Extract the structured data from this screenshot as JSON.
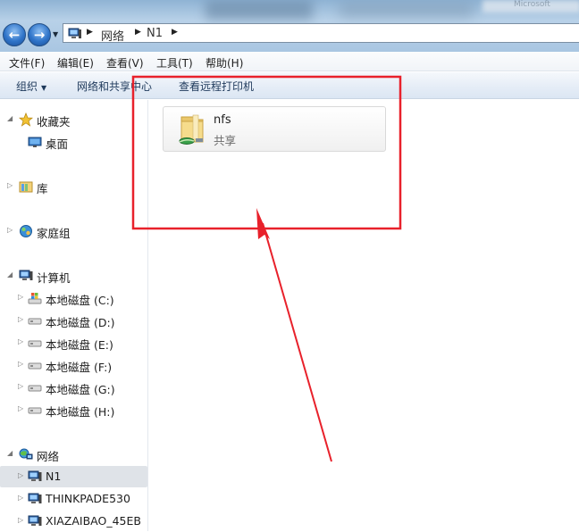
{
  "address": {
    "crumbs": [
      "网络",
      "N1"
    ]
  },
  "menu": [
    "文件(F)",
    "编辑(E)",
    "查看(V)",
    "工具(T)",
    "帮助(H)"
  ],
  "toolbar": {
    "organize": "组织",
    "network_center": "网络和共享中心",
    "view_printers": "查看远程打印机"
  },
  "sidebar": {
    "favorites": "收藏夹",
    "desktop": "桌面",
    "libraries": "库",
    "homegroup": "家庭组",
    "computer": "计算机",
    "drives": [
      "本地磁盘 (C:)",
      "本地磁盘 (D:)",
      "本地磁盘 (E:)",
      "本地磁盘 (F:)",
      "本地磁盘 (G:)",
      "本地磁盘 (H:)"
    ],
    "network": "网络",
    "network_items": [
      "N1",
      "THINKPADE530",
      "XIAZAIBAO_45EB"
    ]
  },
  "content": {
    "share_name": "nfs",
    "share_type": "共享"
  },
  "colors": {
    "annotation": "#e8212b",
    "selected_row": "#dfe3e8",
    "toolbar_text": "#1e395b"
  }
}
